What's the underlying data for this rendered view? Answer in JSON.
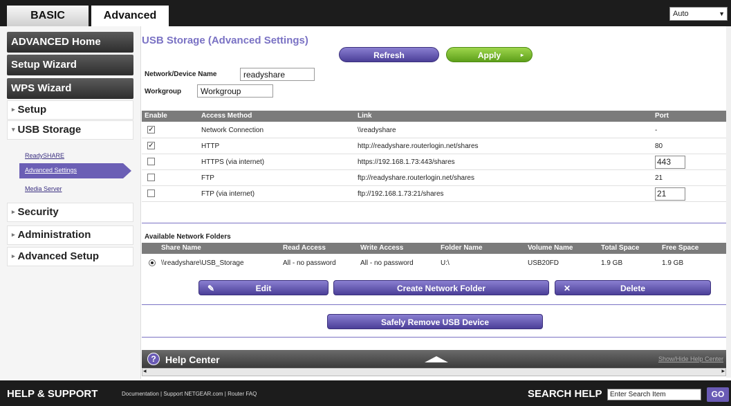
{
  "tabs": {
    "basic": "BASIC",
    "advanced": "Advanced"
  },
  "language": {
    "selected": "Auto"
  },
  "sidebar": {
    "advanced_home": "ADVANCED Home",
    "setup_wizard": "Setup Wizard",
    "wps_wizard": "WPS Wizard",
    "setup": "Setup",
    "usb_storage": "USB Storage",
    "usb_items": [
      "ReadySHARE",
      "Advanced Settings",
      "Media Server"
    ],
    "security": "Security",
    "administration": "Administration",
    "advanced_setup": "Advanced Setup"
  },
  "page": {
    "title": "USB Storage (Advanced Settings)",
    "refresh": "Refresh",
    "apply": "Apply",
    "device_name_label": "Network/Device Name",
    "device_name_value": "readyshare",
    "workgroup_label": "Workgroup",
    "workgroup_value": "Workgroup"
  },
  "access_table": {
    "headers": [
      "Enable",
      "Access Method",
      "Link",
      "Port"
    ],
    "rows": [
      {
        "enabled": true,
        "method": "Network Connection",
        "link": "\\\\readyshare",
        "port": "-"
      },
      {
        "enabled": true,
        "method": "HTTP",
        "link": "http://readyshare.routerlogin.net/shares",
        "port": "80"
      },
      {
        "enabled": false,
        "method": "HTTPS (via internet)",
        "link": "https://192.168.1.73:443/shares",
        "port": "443"
      },
      {
        "enabled": false,
        "method": "FTP",
        "link": "ftp://readyshare.routerlogin.net/shares",
        "port": "21"
      },
      {
        "enabled": false,
        "method": "FTP (via internet)",
        "link": "ftp://192.168.1.73:21/shares",
        "port": "21"
      }
    ]
  },
  "folders": {
    "title": "Available Network Folders",
    "headers": [
      "Share Name",
      "Read Access",
      "Write Access",
      "Folder Name",
      "Volume Name",
      "Total Space",
      "Free Space"
    ],
    "row": {
      "share": "\\\\readyshare\\USB_Storage",
      "read": "All - no password",
      "write": "All - no password",
      "folder": "U:\\",
      "volume": "USB20FD",
      "total": "1.9 GB",
      "free": "1.9 GB"
    },
    "edit": "Edit",
    "create": "Create Network Folder",
    "delete": "Delete",
    "remove": "Safely Remove USB Device"
  },
  "help": {
    "title": "Help Center",
    "showhide": "Show/Hide Help Center"
  },
  "footer": {
    "help_support": "HELP & SUPPORT",
    "links": "Documentation | Support NETGEAR.com | Router FAQ",
    "search_label": "SEARCH HELP",
    "search_placeholder": "Enter Search Item",
    "go": "GO"
  }
}
